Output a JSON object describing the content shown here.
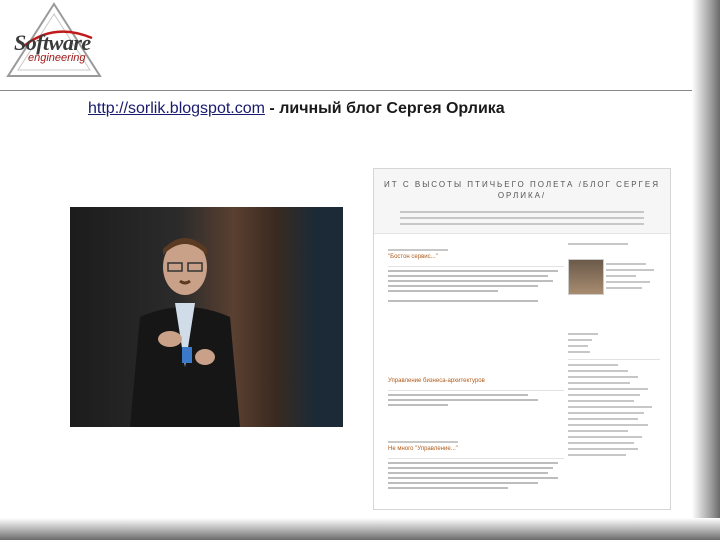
{
  "slide": {
    "logo_line1": "Software",
    "logo_line2": "engineering",
    "headline_url": "http://sorlik.blogspot.com",
    "headline_rest": " - личный блог Сергея Орлика"
  },
  "blog": {
    "title": "ИТ С ВЫСОТЫ ПТИЧЬЕГО ПОЛЕТА /БЛОГ СЕРГЕЯ ОРЛИКА/",
    "posts": [
      {
        "title": "\"Бостон сервис...\""
      },
      {
        "title": "Управление бизнеса-архитектуров"
      },
      {
        "title": "Не много \"Управление...\""
      }
    ]
  },
  "colors": {
    "accent": "#1a1a6e",
    "blog_title": "#555555",
    "post_title": "#b05a18",
    "logo_red": "#a01818"
  }
}
